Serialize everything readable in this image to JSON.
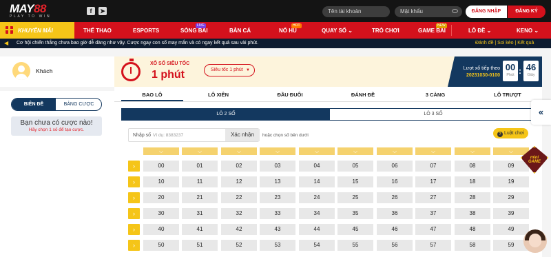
{
  "header": {
    "logo_text_a": "MAY",
    "logo_text_b": "88",
    "logo_tagline": "PLAY TO WIN",
    "social": [
      "f",
      "➤"
    ],
    "username_placeholder": "Tên tài khoản",
    "password_placeholder": "Mật khẩu",
    "login_label": "ĐĂNG NHẬP",
    "register_label": "ĐĂNG KÝ"
  },
  "nav": {
    "promo": "KHUYẾN MÃI",
    "items": [
      "THỂ THAO",
      "ESPORTS",
      "SÒNG BÀI",
      "BẮN CÁ",
      "NỔ HŨ",
      "QUAY SỐ ⌄",
      "TRÒ CHƠI",
      "GAME BÀI",
      "LÔ ĐỀ ⌄",
      "KENO ⌄"
    ],
    "badges": {
      "live": "LIVE",
      "hot": "HOT",
      "new": "NEW"
    }
  },
  "ticker": {
    "text": "Cơ hội chiến thắng chưa bao giờ dễ dàng như vậy. Cược ngay con số may mắn và có ngay kết quả sau vài phút.",
    "links": "Đánh đề | Soi kèo | Kết quả"
  },
  "user": {
    "name": "Khách"
  },
  "sidebar": {
    "tab_active": "BIÊN ĐỀ",
    "tab_inactive": "BẢNG CƯỢC",
    "empty_title": "Bạn chưa có cược nào!",
    "empty_hint": "Hãy chọn 1 số để tạo cược."
  },
  "game": {
    "title_small": "XỔ SỐ SIÊU TỐC",
    "title_big": "1 phút",
    "speed_select": "Siêu tốc 1 phút",
    "next_draw_label": "Lượt xổ tiếp theo",
    "draw_id": "20231030-0100",
    "minutes": "00",
    "minutes_unit": "Phút",
    "seconds": "46",
    "seconds_unit": "Giây",
    "colon": ":"
  },
  "bet_types": [
    "BAO LÔ",
    "LÔ XIÊN",
    "ĐẦU ĐUÔI",
    "ĐÁNH ĐỀ",
    "3 CÀNG",
    "LÔ TRƯỢT"
  ],
  "sub_tabs": [
    "LÔ 2 SỐ",
    "LÔ 3 SỐ"
  ],
  "number_input": {
    "label": "Nhập số",
    "placeholder": "Ví dụ: 8383237",
    "button": "Xác nhận",
    "or_hint": "hoặc chọn số bên dưới",
    "rules": "Luật chơi",
    "rules_icon": "?"
  },
  "grid": {
    "col_marker": "⌵",
    "row_marker": "›",
    "rows": [
      [
        "00",
        "01",
        "02",
        "03",
        "04",
        "05",
        "06",
        "07",
        "08",
        "09"
      ],
      [
        "10",
        "11",
        "12",
        "13",
        "14",
        "15",
        "16",
        "17",
        "18",
        "19"
      ],
      [
        "20",
        "21",
        "22",
        "23",
        "24",
        "25",
        "26",
        "27",
        "28",
        "29"
      ],
      [
        "30",
        "31",
        "32",
        "33",
        "34",
        "35",
        "36",
        "37",
        "38",
        "39"
      ],
      [
        "40",
        "41",
        "42",
        "43",
        "44",
        "45",
        "46",
        "47",
        "48",
        "49"
      ],
      [
        "50",
        "51",
        "52",
        "53",
        "54",
        "55",
        "56",
        "57",
        "58",
        "59"
      ]
    ]
  },
  "widgets": {
    "expand": "«",
    "minigame_line1": "mini",
    "minigame_line2": "GAME"
  },
  "colors": {
    "brand_red": "#d4111c",
    "brand_yellow": "#f5c518",
    "navy": "#13385f"
  }
}
